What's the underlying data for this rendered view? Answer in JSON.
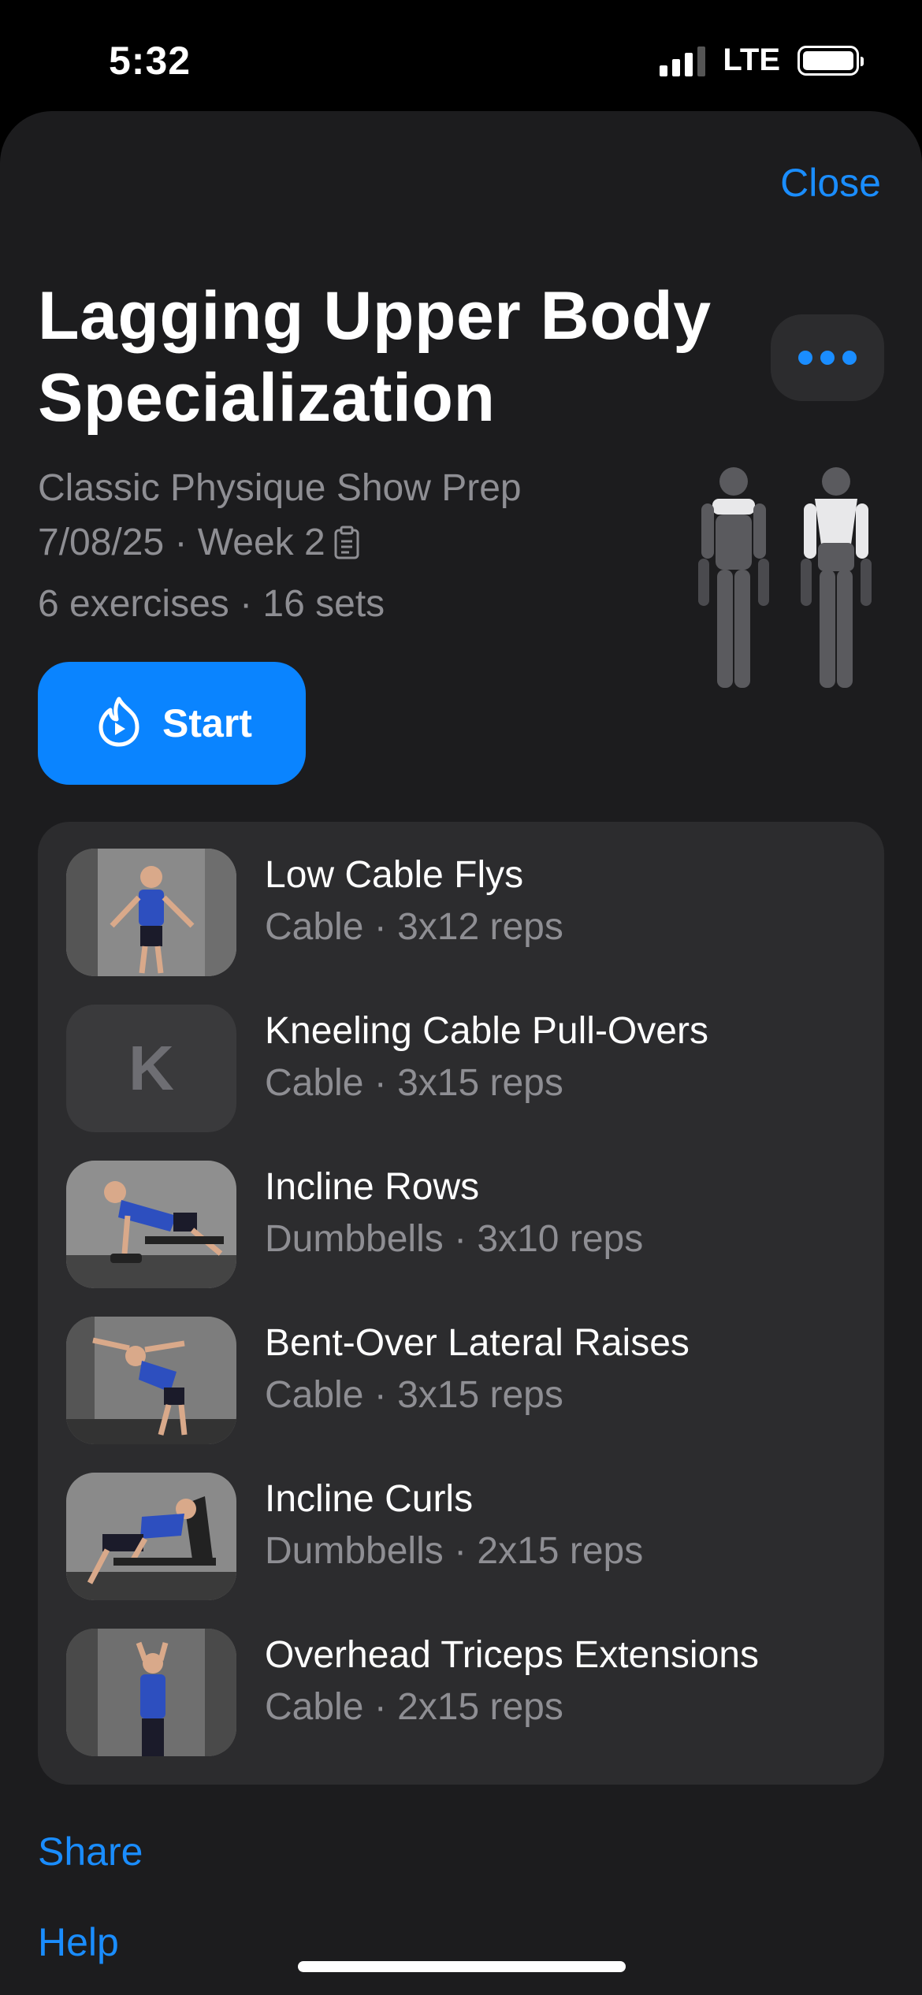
{
  "status_bar": {
    "time": "5:32",
    "network": "LTE",
    "signal_bars_active": 3,
    "signal_bars_total": 4,
    "battery_level": 1.0
  },
  "header": {
    "close_label": "Close",
    "more_icon": "ellipsis-icon"
  },
  "workout": {
    "title": "Lagging Upper Body Specialization",
    "program": "Classic Physique Show Prep",
    "date_week": "7/08/25 · Week 2",
    "summary": "6 exercises · 16 sets",
    "muscle_map_icon": "muscle-map-icon"
  },
  "start": {
    "label": "Start",
    "icon": "flame-play-icon"
  },
  "exercises": [
    {
      "name": "Low Cable Flys",
      "detail": "Cable · 3x12 reps",
      "thumb": "photo"
    },
    {
      "name": "Kneeling Cable Pull-Overs",
      "detail": "Cable · 3x15 reps",
      "thumb": "letter",
      "letter": "K"
    },
    {
      "name": "Incline Rows",
      "detail": "Dumbbells · 3x10 reps",
      "thumb": "photo"
    },
    {
      "name": "Bent-Over Lateral Raises",
      "detail": "Cable · 3x15 reps",
      "thumb": "photo"
    },
    {
      "name": "Incline Curls",
      "detail": "Dumbbells · 2x15 reps",
      "thumb": "photo"
    },
    {
      "name": "Overhead Triceps Extensions",
      "detail": "Cable · 2x15 reps",
      "thumb": "photo"
    }
  ],
  "footer": {
    "share_label": "Share",
    "help_label": "Help"
  },
  "colors": {
    "accent": "#0a84ff",
    "link": "#1a8dff",
    "sheet_background": "#1c1c1e",
    "card_background": "#2c2c2e",
    "secondary_text": "#8e8e93"
  }
}
